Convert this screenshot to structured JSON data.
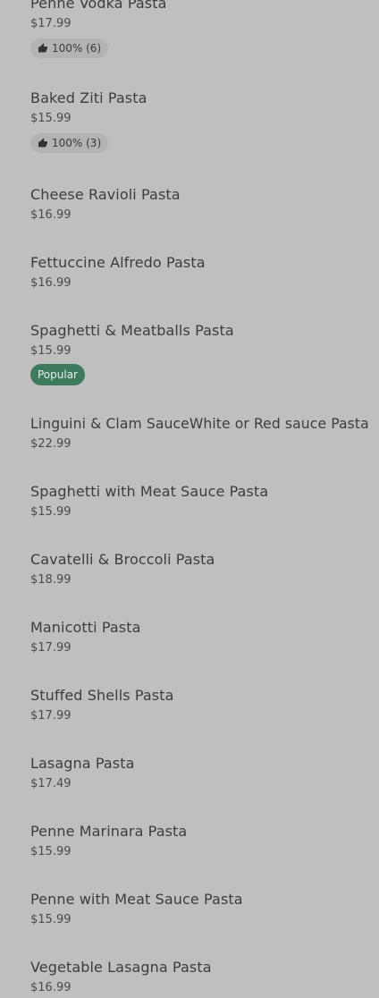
{
  "menu": {
    "items": [
      {
        "name": "Penne Vodka Pasta",
        "price": "$17.99",
        "rating": "100% (6)"
      },
      {
        "name": "Baked Ziti Pasta",
        "price": "$15.99",
        "rating": "100% (3)"
      },
      {
        "name": "Cheese Ravioli Pasta",
        "price": "$16.99"
      },
      {
        "name": "Fettuccine Alfredo Pasta",
        "price": "$16.99"
      },
      {
        "name": "Spaghetti & Meatballs Pasta",
        "price": "$15.99",
        "badge": "Popular"
      },
      {
        "name": "Linguini & Clam SauceWhite or Red sauce Pasta",
        "price": "$22.99"
      },
      {
        "name": "Spaghetti with Meat Sauce Pasta",
        "price": "$15.99"
      },
      {
        "name": "Cavatelli & Broccoli Pasta",
        "price": "$18.99"
      },
      {
        "name": "Manicotti Pasta",
        "price": "$17.99"
      },
      {
        "name": "Stuffed Shells Pasta",
        "price": "$17.99"
      },
      {
        "name": "Lasagna Pasta",
        "price": "$17.49"
      },
      {
        "name": "Penne Marinara Pasta",
        "price": "$15.99"
      },
      {
        "name": "Penne with Meat Sauce Pasta",
        "price": "$15.99"
      },
      {
        "name": "Vegetable Lasagna Pasta",
        "price": "$16.99"
      }
    ]
  },
  "icons": {
    "rating": "thumbs-up-icon"
  },
  "colors": {
    "background": "#bfbfbf",
    "popular_badge": "#3e7a5c",
    "rating_chip": "#b3b3b3"
  }
}
